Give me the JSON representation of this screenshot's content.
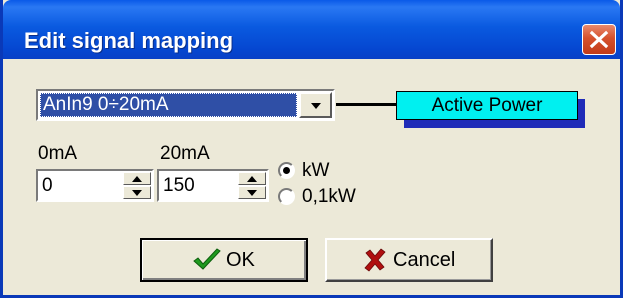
{
  "window": {
    "title": "Edit signal mapping"
  },
  "signal_select": {
    "selected": "AnIn9 0÷20mA"
  },
  "output": {
    "label": "Active Power"
  },
  "range": {
    "low_label": "0mA",
    "high_label": "20mA",
    "low_value": "0",
    "high_value": "150"
  },
  "unit": {
    "options": [
      "kW",
      "0,1kW"
    ],
    "selected": "kW"
  },
  "buttons": {
    "ok": "OK",
    "cancel": "Cancel"
  },
  "colors": {
    "title_bar": "#0a5ae0",
    "close_button": "#d6512c",
    "selection": "#2f4fa6",
    "output_fill": "#00f0f0",
    "output_shadow": "#1f2bb8",
    "ok_check": "#1f9a1f",
    "cancel_x": "#b01010"
  },
  "icons": {
    "close": "close-icon",
    "dropdown": "chevron-down-icon",
    "ok": "checkmark-icon",
    "cancel": "x-mark-icon"
  }
}
